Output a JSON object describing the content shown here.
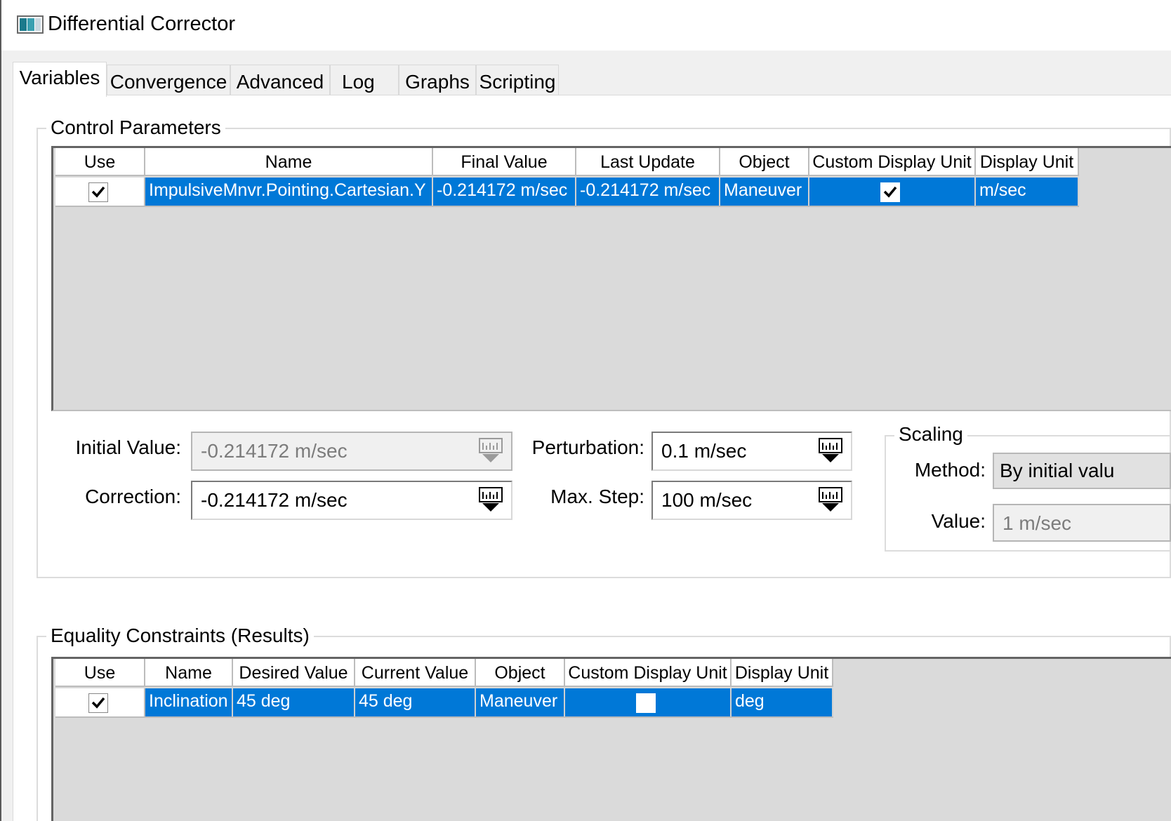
{
  "window": {
    "title": "Differential Corrector"
  },
  "tabs": [
    {
      "label": "Variables",
      "active": true
    },
    {
      "label": "Convergence",
      "active": false
    },
    {
      "label": "Advanced",
      "active": false
    },
    {
      "label": "Log",
      "active": false
    },
    {
      "label": "Graphs",
      "active": false
    },
    {
      "label": "Scripting",
      "active": false
    }
  ],
  "control_parameters": {
    "title": "Control Parameters",
    "columns": [
      "Use",
      "Name",
      "Final Value",
      "Last Update",
      "Object",
      "Custom Display Unit",
      "Display Unit"
    ],
    "rows": [
      {
        "use": true,
        "name": "ImpulsiveMnvr.Pointing.Cartesian.Y",
        "final_value": "-0.214172 m/sec",
        "last_update": "-0.214172 m/sec",
        "object": "Maneuver",
        "custom_display_unit": true,
        "display_unit": "m/sec"
      }
    ],
    "initial_value": {
      "label": "Initial Value:",
      "value": "-0.214172 m/sec"
    },
    "correction": {
      "label": "Correction:",
      "value": "-0.214172 m/sec"
    },
    "perturbation": {
      "label": "Perturbation:",
      "value": "0.1 m/sec"
    },
    "max_step": {
      "label": "Max. Step:",
      "value": "100 m/sec"
    },
    "scaling": {
      "title": "Scaling",
      "method_label": "Method:",
      "method_value": "By initial valu",
      "value_label": "Value:",
      "value": "1 m/sec"
    }
  },
  "equality_constraints": {
    "title": "Equality Constraints (Results)",
    "columns": [
      "Use",
      "Name",
      "Desired Value",
      "Current Value",
      "Object",
      "Custom Display Unit",
      "Display Unit"
    ],
    "rows": [
      {
        "use": true,
        "name": "Inclination",
        "desired_value": "45 deg",
        "current_value": "45 deg",
        "object": "Maneuver",
        "custom_display_unit": false,
        "display_unit": "deg"
      }
    ]
  },
  "colors": {
    "selection": "#0078d7",
    "grid_background": "#dadada"
  }
}
